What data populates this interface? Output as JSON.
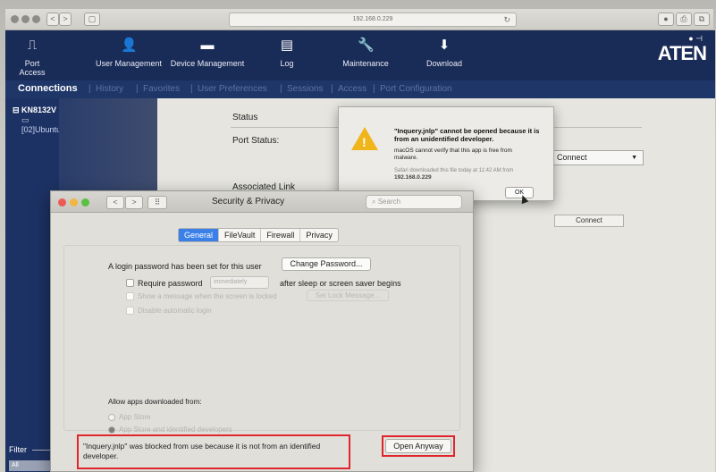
{
  "browser": {
    "url": "192.168.0.229",
    "nav_back": "<",
    "nav_forward": ">",
    "sidebar_btn": "▢",
    "reload": "↻",
    "right_icons": [
      "●",
      "⎙",
      "⧉"
    ]
  },
  "aten": {
    "toolbar": [
      {
        "label": "Port Access",
        "icon": "monitor-icon",
        "glyph": "⎍"
      },
      {
        "label": "User Management",
        "icon": "user-icon",
        "glyph": "👤"
      },
      {
        "label": "Device Management",
        "icon": "drive-icon",
        "glyph": "▬"
      },
      {
        "label": "Log",
        "icon": "document-icon",
        "glyph": "▤"
      },
      {
        "label": "Maintenance",
        "icon": "wrench-icon",
        "glyph": "🔧"
      },
      {
        "label": "Download",
        "icon": "download-icon",
        "glyph": "⬇"
      }
    ],
    "logo": "ATEN",
    "logo_dots": "●  ⊣",
    "tabs": {
      "connections": "Connections",
      "history": "History",
      "favorites": "Favorites",
      "prefs": "User Preferences",
      "sessions": "Sessions",
      "access": "Access",
      "portconfig": "Port Configuration"
    },
    "tree": {
      "root": "⊟ KN8132V",
      "child": "▭ [02]Ubuntu"
    },
    "filter_label": "Filter",
    "filter_value": "All"
  },
  "panel": {
    "status": "Status",
    "port_status": "Port Status:",
    "associated_link": "Associated Link",
    "connect_select": "Connect",
    "connect_button": "Connect"
  },
  "alert": {
    "title": "\"Inquery.jnlp\" cannot be opened because it is from an unidentified developer.",
    "body": "macOS cannot verify that this app is free from malware.",
    "download_info": "Safari downloaded this file today at 11:42 AM from",
    "ip": "192.168.0.229",
    "ok": "OK"
  },
  "security": {
    "title": "Security & Privacy",
    "search_placeholder": "Search",
    "tabs": [
      "General",
      "FileVault",
      "Firewall",
      "Privacy"
    ],
    "login_text": "A login password has been set for this user",
    "change_password": "Change Password...",
    "require_password": "Require password",
    "immediately": "immediately",
    "after_sleep": "after sleep or screen saver begins",
    "show_message": "Show a message when the screen is locked",
    "set_lock_message": "Set Lock Message...",
    "disable_login": "Disable automatic login",
    "allow_apps": "Allow apps downloaded from:",
    "app_store": "App Store",
    "app_store_identified": "App Store and identified developers",
    "blocked_message": "\"Inquery.jnlp\" was blocked from use because it is not from an identified developer.",
    "open_anyway": "Open Anyway"
  },
  "colors": {
    "aten_navy": "#192b57",
    "highlight_red": "#e1252c",
    "selected_tab_blue": "#3a80e8",
    "warning_yellow": "#f1b51c"
  }
}
